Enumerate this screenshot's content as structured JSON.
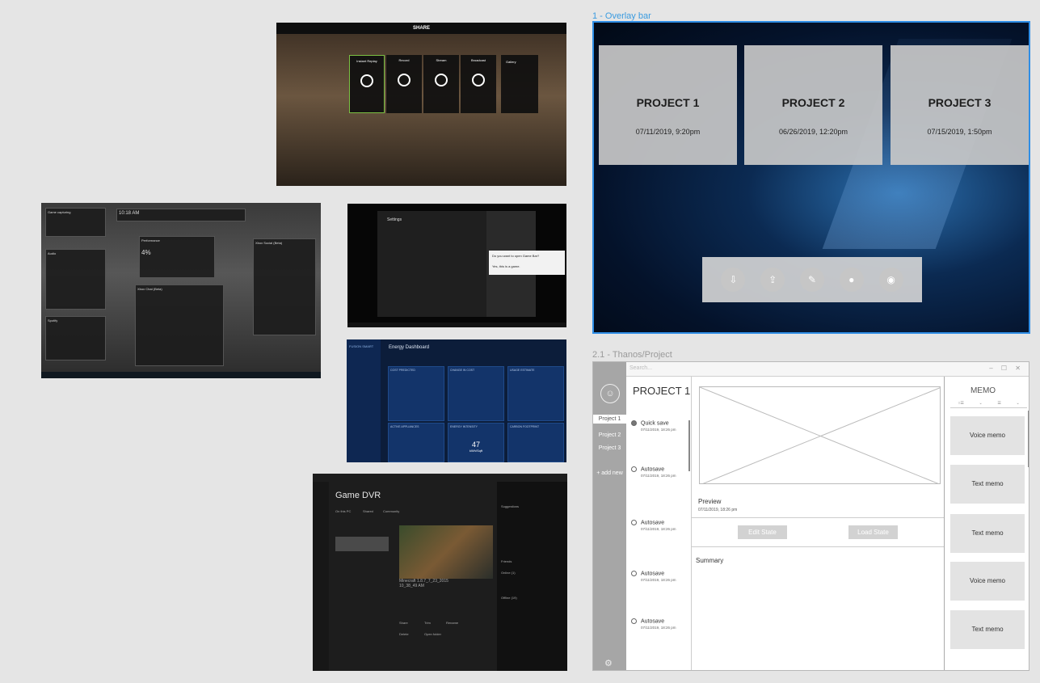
{
  "labels": {
    "overlay": "1 - Overlay bar",
    "thanos": "2.1 - Thanos/Project"
  },
  "share": {
    "title": "SHARE",
    "tiles": [
      "Instant Replay",
      "Record",
      "Stream",
      "Broadcast"
    ],
    "gallery": "Gallery"
  },
  "overlay": {
    "projects": [
      {
        "title": "PROJECT 1",
        "date": "07/11/2019, 9:20pm"
      },
      {
        "title": "PROJECT 2",
        "date": "06/26/2019, 12:20pm"
      },
      {
        "title": "PROJECT 3",
        "date": "07/15/2019, 1:50pm"
      }
    ],
    "toolbar_icons": [
      "download-icon",
      "share-screen-icon",
      "edit-icon",
      "microphone-icon",
      "camera-icon"
    ]
  },
  "gamebar": {
    "clock": "10:18 AM",
    "perf_value": "4%",
    "panels": [
      "Game capturing",
      "Performance",
      "Audio",
      "Spotify",
      "Xbox Social (Beta)",
      "Xbox Chat (Beta)"
    ]
  },
  "settings": {
    "title": "Settings",
    "dialog": "Do you want to open Game Bar?",
    "dialog_check": "Yes, this is a game."
  },
  "fusion": {
    "brand": "FUSION SMART",
    "header": "Energy Dashboard",
    "gauge_value": "47",
    "gauge_unit": "kWh/Sqft",
    "cards": [
      "COST PREDICTED",
      "CHANGE IN COST",
      "USAGE ESTIMATE",
      "ACTIVE APPLIANCES",
      "ENERGY INTENSITY",
      "CARBON FOOTPRINT"
    ]
  },
  "dvr": {
    "title": "Game DVR",
    "tabs": [
      "On this PC",
      "Shared",
      "Community"
    ],
    "clip": "Minecraft 1.8.7_7_23_2015 10_38_49 AM",
    "actions": [
      "Share",
      "Trim",
      "Rename",
      "Delete",
      "Open folder"
    ],
    "sections": [
      "Suggestions",
      "Friends",
      "Online (1)",
      "Offline (19)"
    ]
  },
  "thanos": {
    "search_placeholder": "Search...",
    "window_controls": "– ☐ ✕",
    "project_title": "PROJECT 1",
    "sidebar": [
      "Project 1",
      "Project 2",
      "Project 3",
      "+ add new"
    ],
    "saves": [
      {
        "label": "Quick save",
        "ts": "07/11/2019, 18:26 pm"
      },
      {
        "label": "Autosave",
        "ts": "07/11/2019, 18:26 pm"
      },
      {
        "label": "Autosave",
        "ts": "07/11/2019, 18:26 pm"
      },
      {
        "label": "Autosave",
        "ts": "07/11/2019, 18:26 pm"
      },
      {
        "label": "Autosave",
        "ts": "07/11/2019, 18:26 pm"
      }
    ],
    "preview_label": "Preview",
    "preview_ts": "07/11/2019, 18:26 pm",
    "edit_state": "Edit State",
    "load_state": "Load State",
    "summary": "Summary",
    "memo_title": "MEMO",
    "memos": [
      "Voice memo",
      "Text memo",
      "Text memo",
      "Voice memo",
      "Text memo"
    ]
  }
}
